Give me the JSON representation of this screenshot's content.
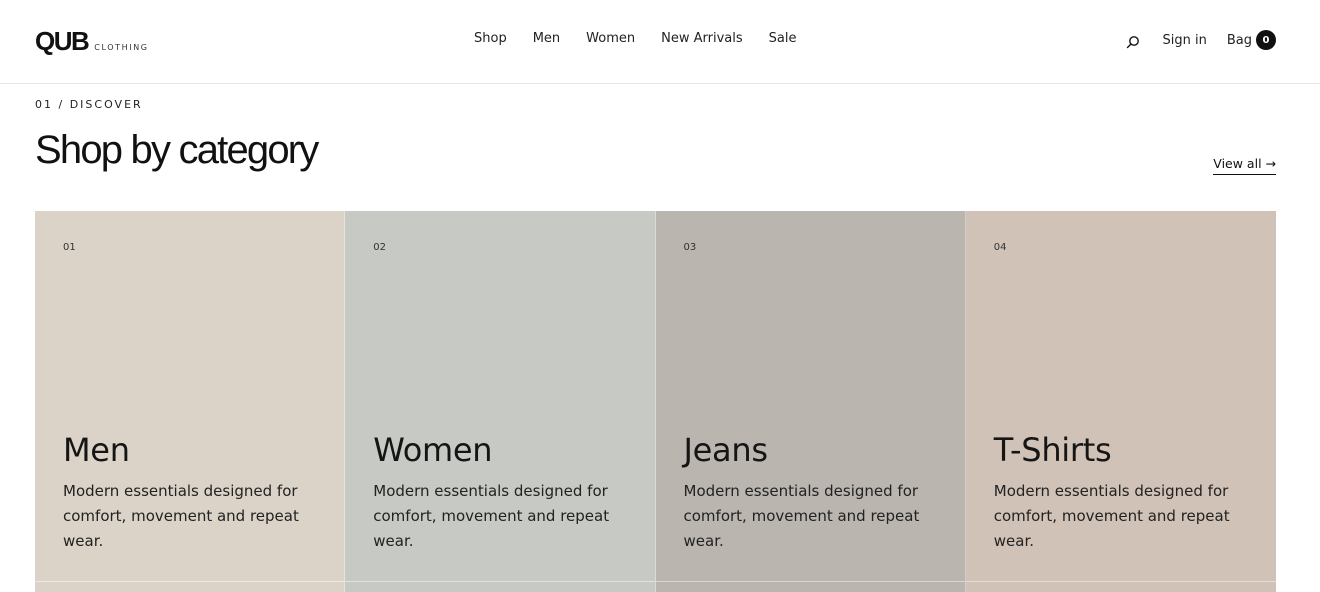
{
  "header": {
    "logo": {
      "mark": "QUB",
      "sub": "CLOTHING"
    },
    "nav": [
      {
        "label": "Shop"
      },
      {
        "label": "Men"
      },
      {
        "label": "Women"
      },
      {
        "label": "New Arrivals"
      },
      {
        "label": "Sale"
      }
    ],
    "search_icon": "search-icon",
    "signin_label": "Sign in",
    "bag_label": "Bag",
    "bag_count": "0"
  },
  "section": {
    "eyebrow": "01 / DISCOVER",
    "title": "Shop by category",
    "view_all": "View all →"
  },
  "categories": [
    {
      "num": "01",
      "title": "Men",
      "desc": "Modern essentials designed for comfort, movement and repeat wear.",
      "color": "#dbd3c8"
    },
    {
      "num": "02",
      "title": "Women",
      "desc": "Modern essentials designed for comfort, movement and repeat wear.",
      "color": "#c7c9c4"
    },
    {
      "num": "03",
      "title": "Jeans",
      "desc": "Modern essentials designed for comfort, movement and repeat wear.",
      "color": "#bab5af"
    },
    {
      "num": "04",
      "title": "T-Shirts",
      "desc": "Modern essentials designed for comfort, movement and repeat wear.",
      "color": "#d0c2b7"
    }
  ],
  "colors": {
    "accent": "#111111",
    "divider": "#e6e6e6"
  }
}
